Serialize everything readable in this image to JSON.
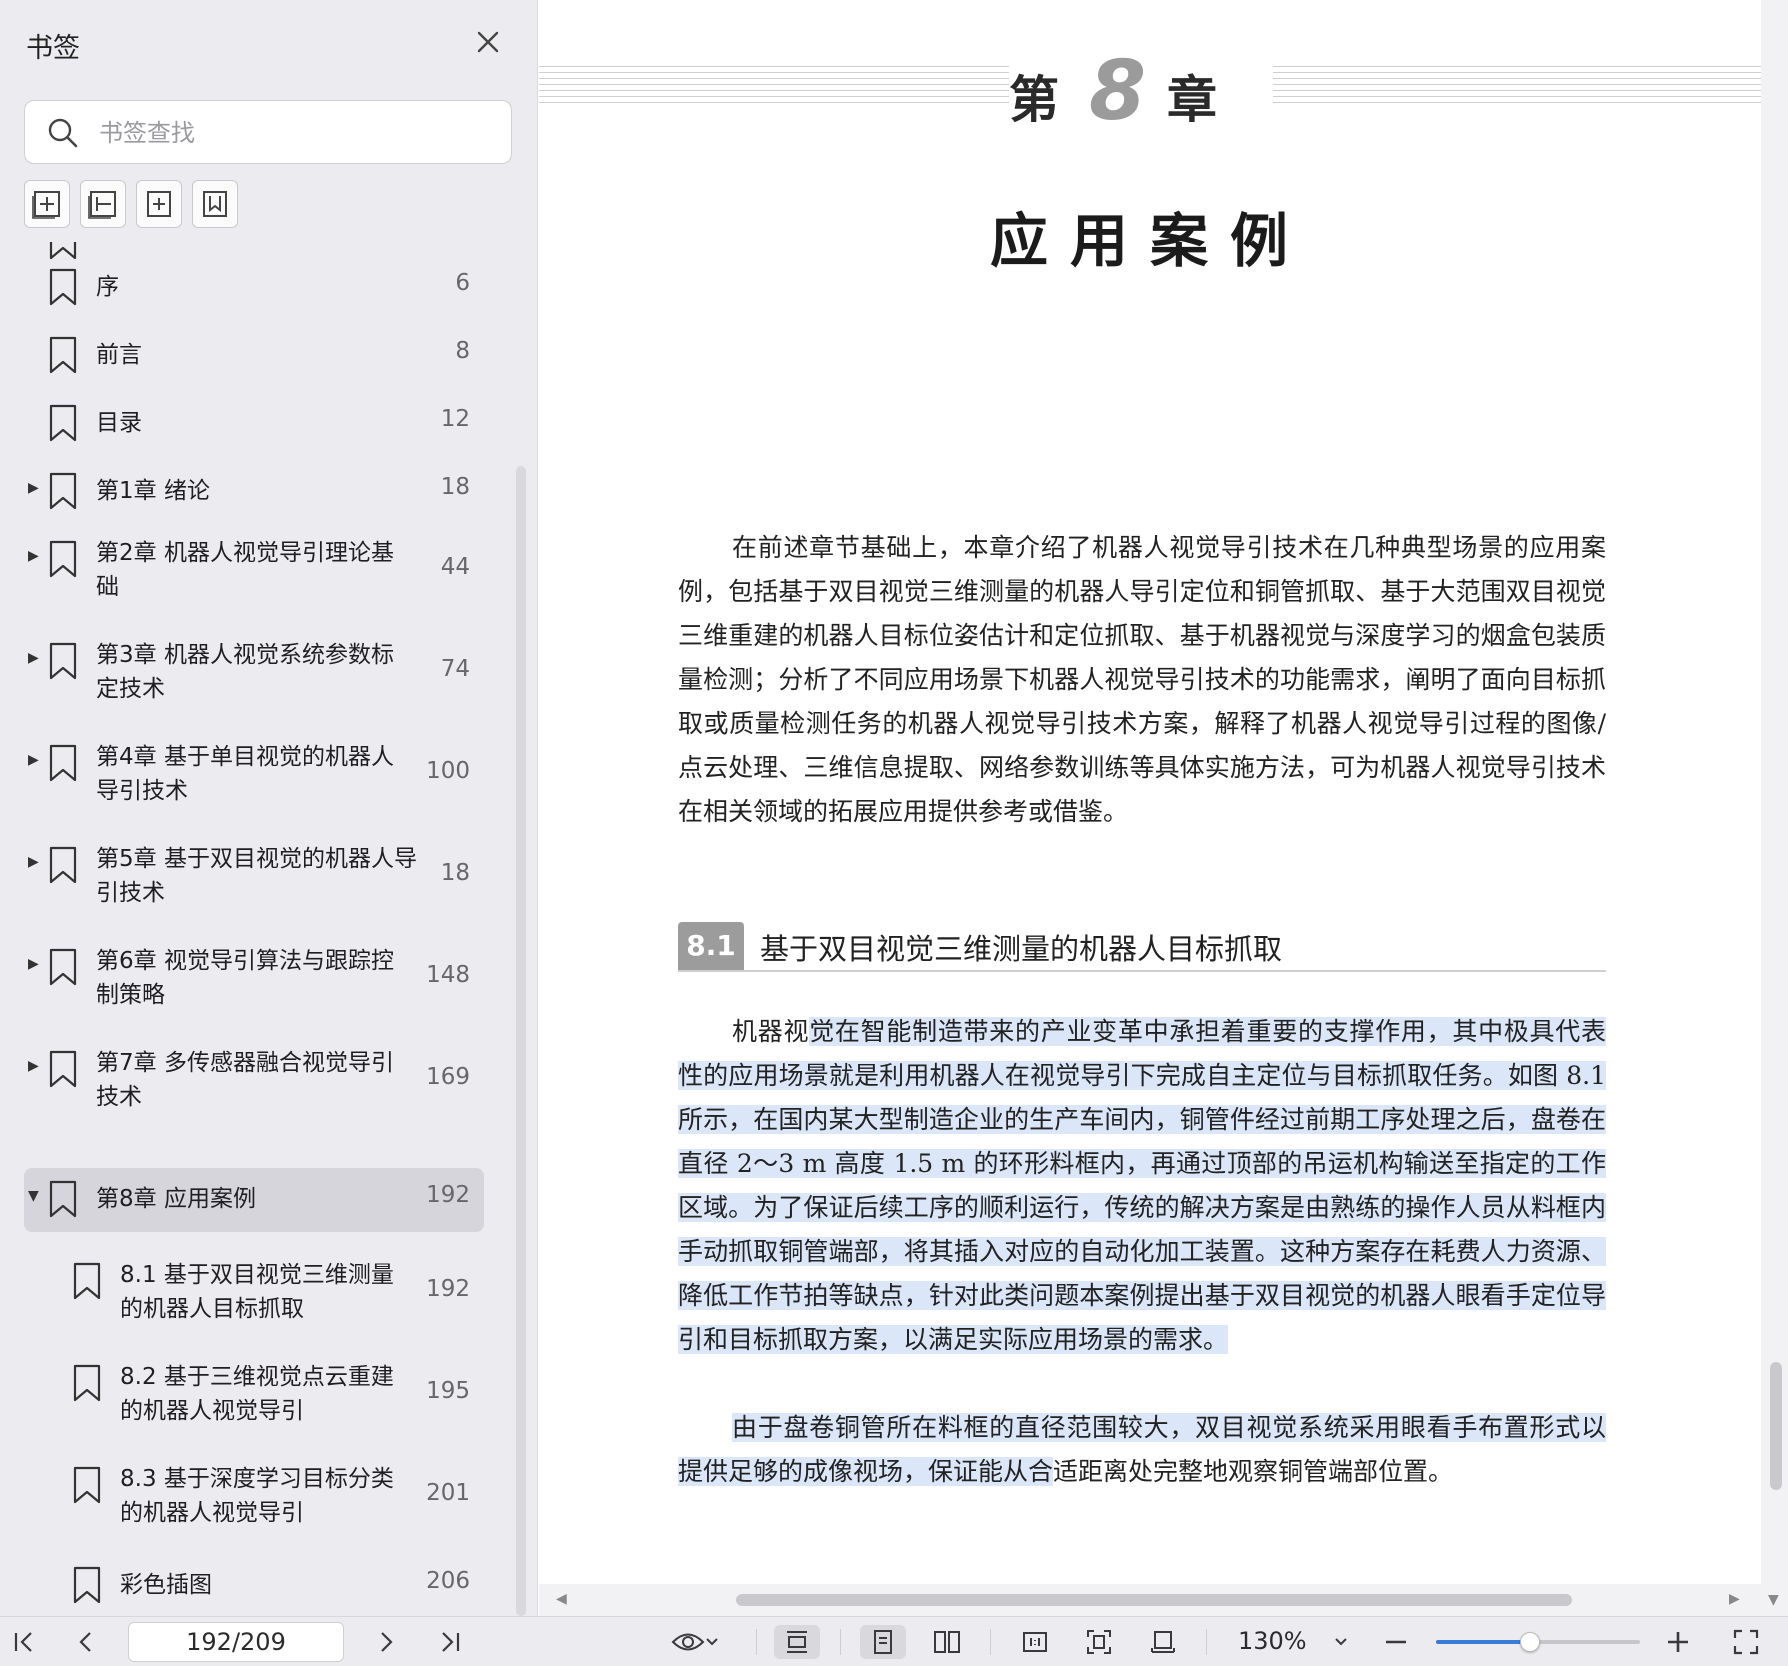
{
  "sidebar": {
    "title": "书签",
    "search_placeholder": "书签查找",
    "items": [
      {
        "label": "序",
        "page": "6",
        "level": 0,
        "expandable": false,
        "active": false
      },
      {
        "label": "前言",
        "page": "8",
        "level": 0,
        "expandable": false,
        "active": false
      },
      {
        "label": "目录",
        "page": "12",
        "level": 0,
        "expandable": false,
        "active": false
      },
      {
        "label": "第1章 绪论",
        "page": "18",
        "level": 0,
        "expandable": true,
        "expanded": false,
        "active": false
      },
      {
        "label": "第2章 机器人视觉导引理论基础",
        "page": "44",
        "level": 0,
        "expandable": true,
        "expanded": false,
        "active": false
      },
      {
        "label": "第3章 机器人视觉系统参数标定技术",
        "page": "74",
        "level": 0,
        "expandable": true,
        "expanded": false,
        "active": false
      },
      {
        "label": "第4章 基于单目视觉的机器人导引技术",
        "page": "100",
        "level": 0,
        "expandable": true,
        "expanded": false,
        "active": false
      },
      {
        "label": "第5章 基于双目视觉的机器人导引技术",
        "page": "18",
        "level": 0,
        "expandable": true,
        "expanded": false,
        "active": false
      },
      {
        "label": "第6章 视觉导引算法与跟踪控制策略",
        "page": "148",
        "level": 0,
        "expandable": true,
        "expanded": false,
        "active": false
      },
      {
        "label": "第7章 多传感器融合视觉导引技术",
        "page": "169",
        "level": 0,
        "expandable": true,
        "expanded": false,
        "active": false
      },
      {
        "label": "第8章 应用案例",
        "page": "192",
        "level": 0,
        "expandable": true,
        "expanded": true,
        "active": true
      },
      {
        "label": "8.1 基于双目视觉三维测量的机器人目标抓取",
        "page": "192",
        "level": 1,
        "expandable": false,
        "active": false
      },
      {
        "label": "8.2 基于三维视觉点云重建的机器人视觉导引",
        "page": "195",
        "level": 1,
        "expandable": false,
        "active": false
      },
      {
        "label": "8.3 基于深度学习目标分类的机器人视觉导引",
        "page": "201",
        "level": 1,
        "expandable": false,
        "active": false
      },
      {
        "label": "彩色插图",
        "page": "206",
        "level": 1,
        "expandable": false,
        "active": false
      }
    ]
  },
  "document": {
    "chapter_prefix": "第",
    "chapter_number": "8",
    "chapter_suffix": "章",
    "chapter_title": "应用案例",
    "intro": "在前述章节基础上，本章介绍了机器人视觉导引技术在几种典型场景的应用案例，包括基于双目视觉三维测量的机器人导引定位和铜管抓取、基于大范围双目视觉三维重建的机器人目标位姿估计和定位抓取、基于机器视觉与深度学习的烟盒包装质量检测；分析了不同应用场景下机器人视觉导引技术的功能需求，阐明了面向目标抓取或质量检测任务的机器人视觉导引技术方案，解释了机器人视觉导引过程的图像/点云处理、三维信息提取、网络参数训练等具体实施方法，可为机器人视觉导引技术在相关领域的拓展应用提供参考或借鉴。",
    "section_number": "8.1",
    "section_title": "基于双目视觉三维测量的机器人目标抓取",
    "para1_lead": "机器视",
    "para1_sel": "觉在智能制造带来的产业变革中承担着重要的支撑作用，其中极具代表性的应用场景就是利用机器人在视觉导引下完成自主定位与目标抓取任务。如图 8.1 所示，在国内某大型制造企业的生产车间内，铜管件经过前期工序处理之后，盘卷在直径 2～3 m 高度 1.5 m 的环形料框内，再通过顶部的吊运机构输送至指定的工作区域。为了保证后续工序的顺利运行，传统的解决方案是由熟练的操作人员从料框内手动抓取铜管端部，将其插入对应的自动化加工装置。这种方案存在耗费人力资源、降低工作节拍等缺点，针对此类问题本案例提出基于双目视觉的机器人眼看手定位导引和目标抓取方案，以满足实际应用场景的需求。",
    "para2_sel": "由于盘卷铜管所在料框的直径范围较大，双目视觉系统采用眼看手布置形式以提供足够的成像视场，保证能从合",
    "para2_tail": "适距离处完整地观察铜管端部位置。"
  },
  "toolbar": {
    "page_value": "192/209",
    "zoom": "130%",
    "zoom_fraction": 0.46
  },
  "colors": {
    "selection": "#dbe6f8",
    "accent": "#3b7bd8",
    "active_row": "#d7d5dc"
  }
}
